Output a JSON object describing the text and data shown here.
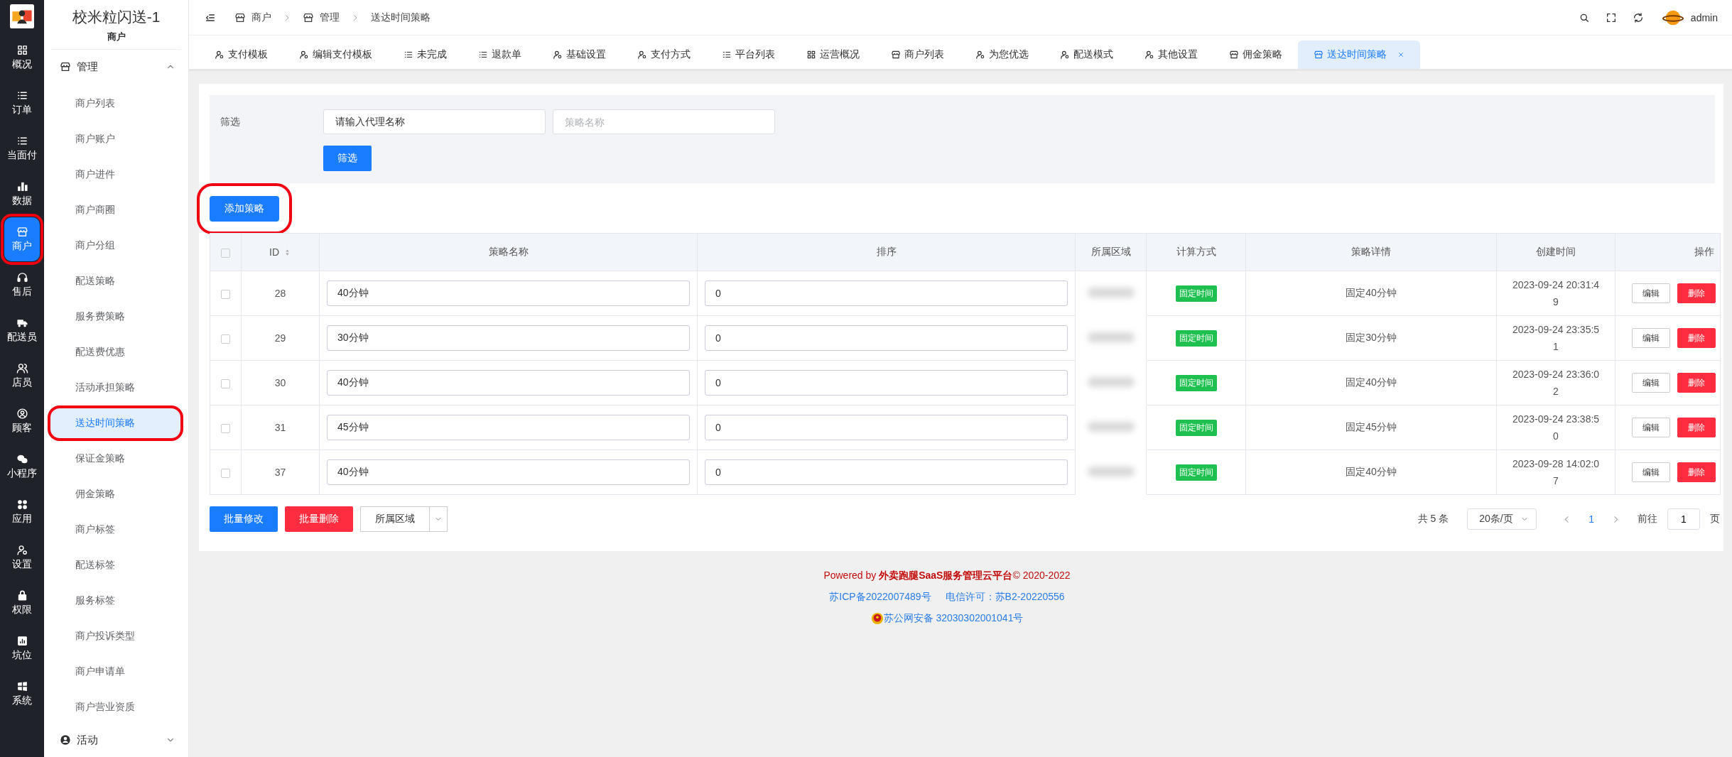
{
  "rail": [
    {
      "label": "概况",
      "selected": false,
      "highlighted": false
    },
    {
      "label": "订单",
      "selected": false,
      "highlighted": false
    },
    {
      "label": "当面付",
      "selected": false,
      "highlighted": false
    },
    {
      "label": "数据",
      "selected": false,
      "highlighted": false
    },
    {
      "label": "商户",
      "selected": true,
      "highlighted": true
    },
    {
      "label": "售后",
      "selected": false,
      "highlighted": false
    },
    {
      "label": "配送员",
      "selected": false,
      "highlighted": false
    },
    {
      "label": "店员",
      "selected": false,
      "highlighted": false
    },
    {
      "label": "顾客",
      "selected": false,
      "highlighted": false
    },
    {
      "label": "小程序",
      "selected": false,
      "highlighted": false
    },
    {
      "label": "应用",
      "selected": false,
      "highlighted": false
    },
    {
      "label": "设置",
      "selected": false,
      "highlighted": false
    },
    {
      "label": "权限",
      "selected": false,
      "highlighted": false
    },
    {
      "label": "坑位",
      "selected": false,
      "highlighted": false
    },
    {
      "label": "系统",
      "selected": false,
      "highlighted": false
    }
  ],
  "sidebar": {
    "title": "校米粒闪送-1",
    "section": "商户",
    "groups": [
      {
        "label": "管理",
        "expanded": true,
        "items": [
          {
            "label": "商户列表",
            "selected": false,
            "highlighted": false
          },
          {
            "label": "商户账户",
            "selected": false,
            "highlighted": false
          },
          {
            "label": "商户进件",
            "selected": false,
            "highlighted": false
          },
          {
            "label": "商户商圈",
            "selected": false,
            "highlighted": false
          },
          {
            "label": "商户分组",
            "selected": false,
            "highlighted": false
          },
          {
            "label": "配送策略",
            "selected": false,
            "highlighted": false
          },
          {
            "label": "服务费策略",
            "selected": false,
            "highlighted": false
          },
          {
            "label": "配送费优惠",
            "selected": false,
            "highlighted": false
          },
          {
            "label": "活动承担策略",
            "selected": false,
            "highlighted": false
          },
          {
            "label": "送达时间策略",
            "selected": true,
            "highlighted": true
          },
          {
            "label": "保证金策略",
            "selected": false,
            "highlighted": false
          },
          {
            "label": "佣金策略",
            "selected": false,
            "highlighted": false
          },
          {
            "label": "商户标签",
            "selected": false,
            "highlighted": false
          },
          {
            "label": "配送标签",
            "selected": false,
            "highlighted": false
          },
          {
            "label": "服务标签",
            "selected": false,
            "highlighted": false
          },
          {
            "label": "商户投诉类型",
            "selected": false,
            "highlighted": false
          },
          {
            "label": "商户申请单",
            "selected": false,
            "highlighted": false
          },
          {
            "label": "商户营业资质",
            "selected": false,
            "highlighted": false
          }
        ]
      },
      {
        "label": "活动",
        "expanded": false
      }
    ]
  },
  "breadcrumb": [
    "商户",
    "管理",
    "送达时间策略"
  ],
  "header": {
    "user": "admin"
  },
  "tabs": [
    {
      "label": "支付模板",
      "selected": false,
      "closable": false
    },
    {
      "label": "编辑支付模板",
      "selected": false,
      "closable": false
    },
    {
      "label": "未完成",
      "selected": false,
      "closable": false
    },
    {
      "label": "退款单",
      "selected": false,
      "closable": false
    },
    {
      "label": "基础设置",
      "selected": false,
      "closable": false
    },
    {
      "label": "支付方式",
      "selected": false,
      "closable": false
    },
    {
      "label": "平台列表",
      "selected": false,
      "closable": false
    },
    {
      "label": "运营概况",
      "selected": false,
      "closable": false
    },
    {
      "label": "商户列表",
      "selected": false,
      "closable": false
    },
    {
      "label": "为您优选",
      "selected": false,
      "closable": false
    },
    {
      "label": "配送模式",
      "selected": false,
      "closable": false
    },
    {
      "label": "其他设置",
      "selected": false,
      "closable": false
    },
    {
      "label": "佣金策略",
      "selected": false,
      "closable": false
    },
    {
      "label": "送达时间策略",
      "selected": true,
      "closable": true
    }
  ],
  "filter": {
    "label": "筛选",
    "fields": [
      {
        "value": "请输入代理名称"
      },
      {
        "placeholder": "策略名称"
      }
    ],
    "button": "筛选"
  },
  "add_button": {
    "label": "添加策略",
    "highlighted": true
  },
  "table": {
    "all_checked": false,
    "columns": [
      "ID",
      "策略名称",
      "排序",
      "所属区域",
      "计算方式",
      "策略详情",
      "创建时间",
      "操作"
    ],
    "rows": [
      {
        "checked": false,
        "id": "28",
        "name": "40分钟",
        "sort": "0",
        "method": "固定时间",
        "detail": "固定40分钟",
        "created": "2023-09-24 20:31:49",
        "actions": [
          "编辑",
          "删除"
        ]
      },
      {
        "checked": false,
        "id": "29",
        "name": "30分钟",
        "sort": "0",
        "method": "固定时间",
        "detail": "固定30分钟",
        "created": "2023-09-24 23:35:51",
        "actions": [
          "编辑",
          "删除"
        ]
      },
      {
        "checked": false,
        "id": "30",
        "name": "40分钟",
        "sort": "0",
        "method": "固定时间",
        "detail": "固定40分钟",
        "created": "2023-09-24 23:36:02",
        "actions": [
          "编辑",
          "删除"
        ]
      },
      {
        "checked": false,
        "id": "31",
        "name": "45分钟",
        "sort": "0",
        "method": "固定时间",
        "detail": "固定45分钟",
        "created": "2023-09-24 23:38:50",
        "actions": [
          "编辑",
          "删除"
        ]
      },
      {
        "checked": false,
        "id": "37",
        "name": "40分钟",
        "sort": "0",
        "method": "固定时间",
        "detail": "固定40分钟",
        "created": "2023-09-28 14:02:07",
        "actions": [
          "编辑",
          "删除"
        ]
      }
    ]
  },
  "bulk": {
    "buttons": [
      {
        "label": "批量修改",
        "kind": "primary"
      },
      {
        "label": "批量删除",
        "kind": "danger"
      }
    ],
    "region_select": "所属区域"
  },
  "pagination": {
    "total": "共 5 条",
    "page_size": "20条/页",
    "pages": [
      {
        "label": "1",
        "selected": true
      }
    ],
    "goto_label": "前往",
    "goto_value": "1",
    "goto_suffix": "页"
  },
  "footer": {
    "powered": "Powered by **外卖跑腿SaaS服务管理云平台**© 2020-2022",
    "icp": "苏ICP备2022007489号",
    "license": "电信许可：苏B2-20220556",
    "police": "苏公网安备 32030302001041号"
  }
}
